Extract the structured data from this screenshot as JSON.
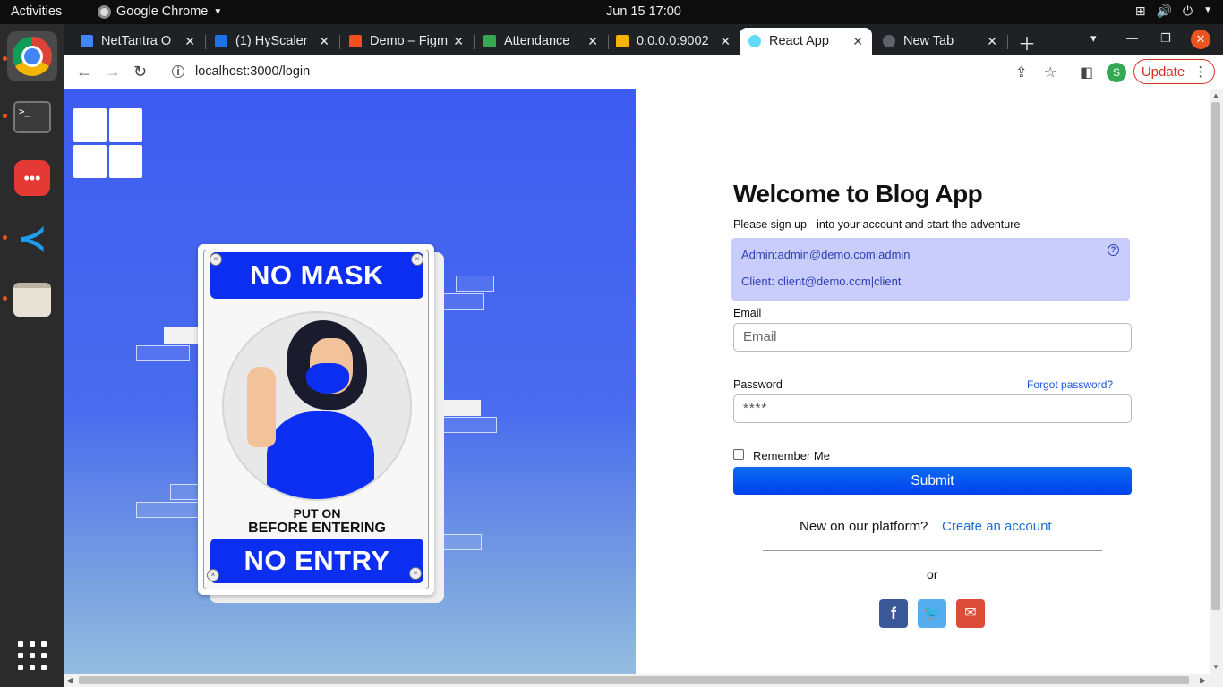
{
  "topbar": {
    "activities": "Activities",
    "app_name": "Google Chrome",
    "clock": "Jun 15  17:00"
  },
  "browser": {
    "tabs": [
      {
        "title": "NetTantra O",
        "favicon_color": "#4285f4"
      },
      {
        "title": "(1) HyScaler",
        "favicon_color": "#1a73e8"
      },
      {
        "title": "Demo – Figm",
        "favicon_color": "#f24e1e"
      },
      {
        "title": "Attendance",
        "favicon_color": "#34a853"
      },
      {
        "title": "0.0.0.0:9002",
        "favicon_color": "#f4b400"
      },
      {
        "title": "React App",
        "favicon_color": "#61dafb"
      },
      {
        "title": "New Tab",
        "favicon_color": "#5f6368"
      }
    ],
    "url": "localhost:3000/login",
    "update_label": "Update",
    "profile_initial": "S"
  },
  "sign": {
    "top_banner": "NO MASK",
    "put_on": "PUT ON",
    "before_entering": "BEFORE ENTERING",
    "bottom_banner": "NO ENTRY"
  },
  "login": {
    "title": "Welcome to Blog App",
    "subtitle": "Please sign up - into your account and start the adventure",
    "admin_credentials": "Admin:admin@demo.com|admin",
    "client_credentials": "Client: client@demo.com|client",
    "email_label": "Email",
    "email_placeholder": "Email",
    "password_label": "Password",
    "password_value": "****",
    "forgot_label": "Forgot password?",
    "remember_label": "Remember Me",
    "submit_label": "Submit",
    "new_on_platform": "New on our platform?",
    "create_account": "Create an account",
    "or_label": "or"
  },
  "colors": {
    "primary_blue": "#0b2ef0",
    "panel_blue": "#3d5cf0",
    "facebook": "#3b5998",
    "twitter": "#55acee",
    "mail": "#dd4b39"
  }
}
